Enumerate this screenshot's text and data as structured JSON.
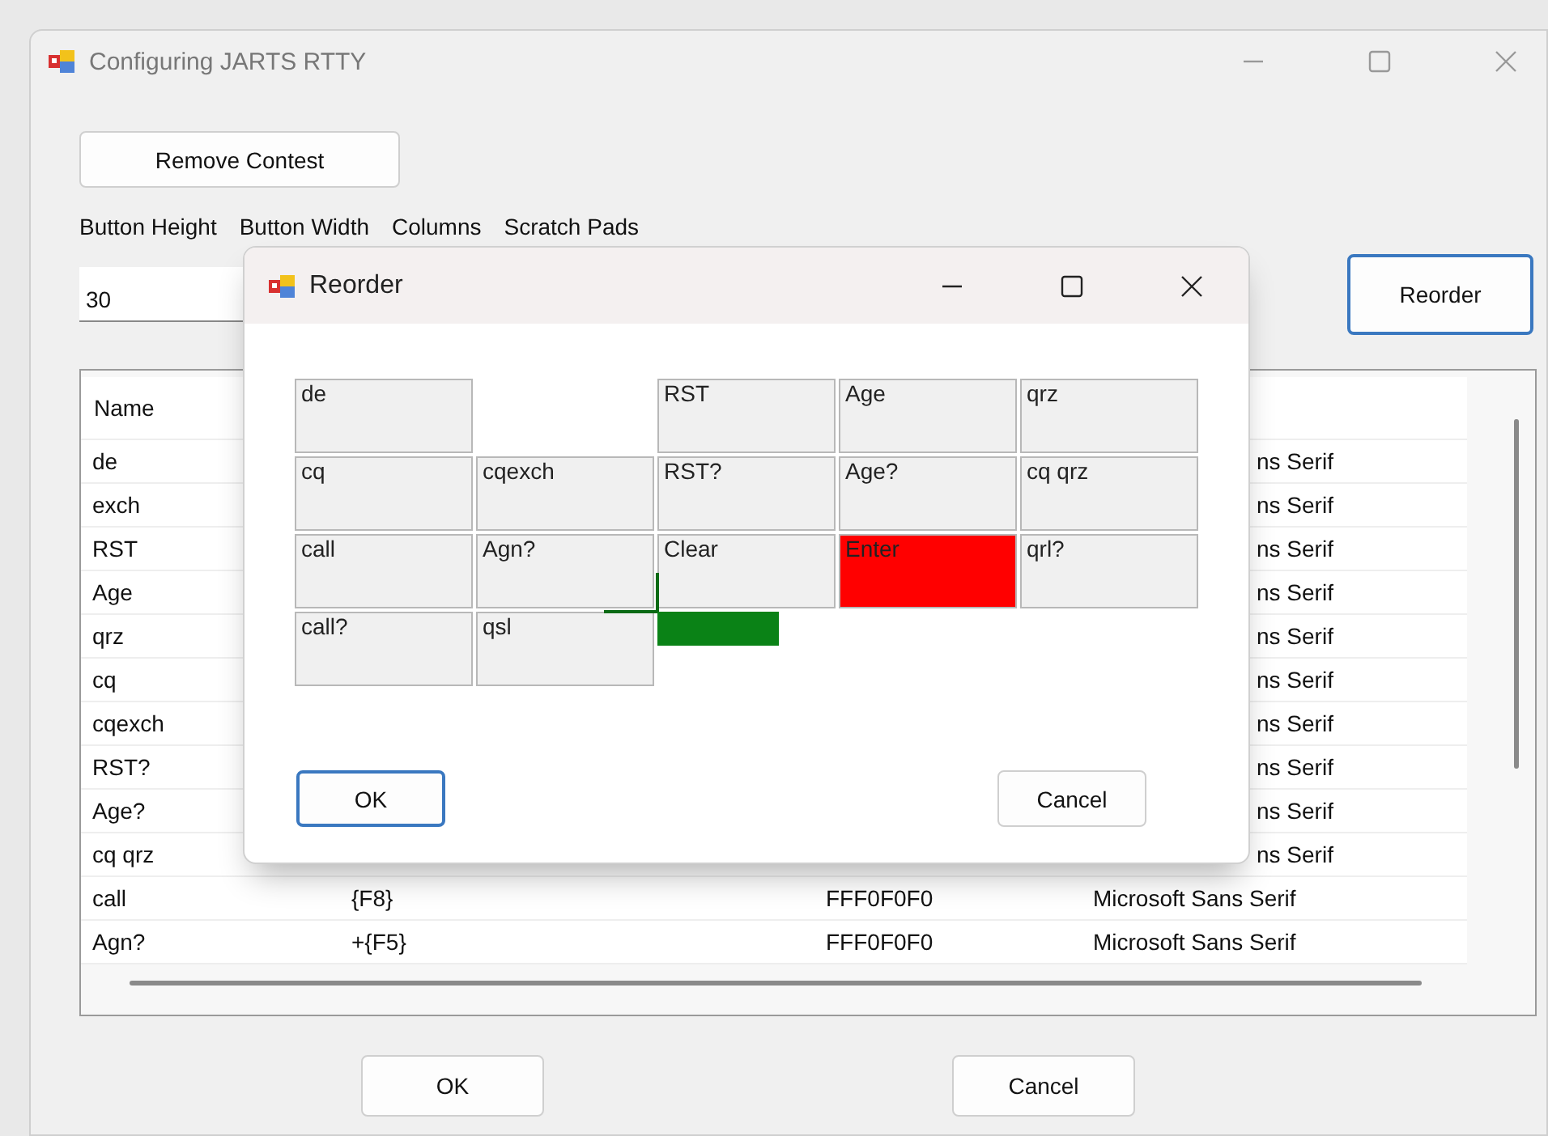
{
  "window": {
    "title": "Configuring JARTS RTTY"
  },
  "remove_button": {
    "label": "Remove Contest",
    "focused": false
  },
  "labels": [
    "Button Height",
    "Button Width",
    "Columns",
    "Scratch Pads"
  ],
  "height_field": {
    "value": "30"
  },
  "reorder_button": {
    "label": "Reorder",
    "focused": true
  },
  "table": {
    "columns": [
      "Name"
    ],
    "rows": [
      {
        "name": "de",
        "column_4": "ns Serif"
      },
      {
        "name": "exch",
        "column_4": "ns Serif"
      },
      {
        "name": "RST",
        "column_4": "ns Serif"
      },
      {
        "name": "Age",
        "column_4": "ns Serif"
      },
      {
        "name": "qrz",
        "column_4": "ns Serif"
      },
      {
        "name": "cq",
        "column_4": "ns Serif"
      },
      {
        "name": "cqexch",
        "column_4": "ns Serif"
      },
      {
        "name": "RST?",
        "column_4": "ns Serif"
      },
      {
        "name": "Age?",
        "column_4": "ns Serif"
      },
      {
        "name": "cq qrz",
        "column_4": "ns Serif"
      },
      {
        "name": "call",
        "column_2": "{F8}",
        "column_3": "FFF0F0F0",
        "column_4": "Microsoft Sans Serif"
      },
      {
        "name": "Agn?",
        "column_2": "+{F5}",
        "column_3": "FFF0F0F0",
        "column_4": "Microsoft Sans Serif"
      }
    ]
  },
  "buttons": [
    {
      "label": "OK",
      "focused": false
    },
    {
      "label": "Cancel",
      "focused": false
    }
  ],
  "dialog": {
    "title": "Reorder",
    "tiles": [
      {
        "kind": "button",
        "label": "de",
        "color": "#f0f0f0"
      },
      {
        "kind": "empty"
      },
      {
        "kind": "button",
        "label": "RST",
        "color": "#f0f0f0"
      },
      {
        "kind": "button",
        "label": "Age",
        "color": "#f0f0f0"
      },
      {
        "kind": "button",
        "label": "qrz",
        "color": "#f0f0f0"
      },
      {
        "kind": "button",
        "label": "cq",
        "color": "#f0f0f0"
      },
      {
        "kind": "button",
        "label": "cqexch",
        "color": "#f0f0f0"
      },
      {
        "kind": "button",
        "label": "RST?",
        "color": "#f0f0f0"
      },
      {
        "kind": "button",
        "label": "Age?",
        "color": "#f0f0f0"
      },
      {
        "kind": "button",
        "label": "cq qrz",
        "color": "#f0f0f0"
      },
      {
        "kind": "button",
        "label": "call",
        "color": "#f0f0f0"
      },
      {
        "kind": "button",
        "label": "Agn?",
        "color": "#f0f0f0"
      },
      {
        "kind": "button",
        "label": "Clear",
        "color": "#f0f0f0"
      },
      {
        "kind": "button",
        "label": "Enter",
        "color": "#ff0000"
      },
      {
        "kind": "button",
        "label": "qrl?",
        "color": "#f0f0f0"
      },
      {
        "kind": "button",
        "label": "call?",
        "color": "#f0f0f0"
      },
      {
        "kind": "button",
        "label": "qsl",
        "color": "#f0f0f0"
      },
      {
        "kind": "drop_marker"
      }
    ],
    "buttons": [
      {
        "label": "OK",
        "focused": true
      },
      {
        "label": "Cancel",
        "focused": false
      }
    ]
  }
}
